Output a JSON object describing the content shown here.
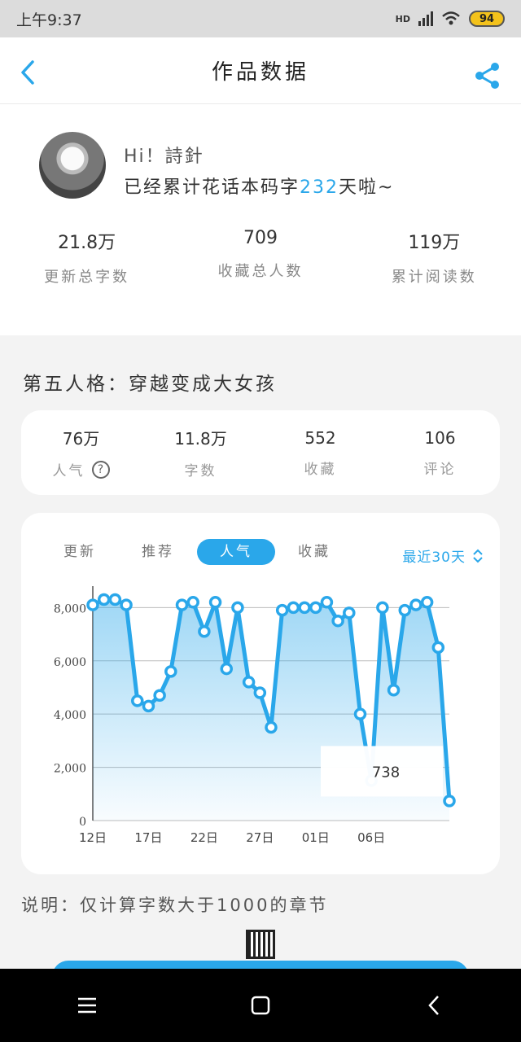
{
  "status": {
    "time": "上午9:37",
    "hd": "HD",
    "battery": "94"
  },
  "header": {
    "title": "作品数据"
  },
  "profile": {
    "greeting": "Hi！詩針",
    "words_prefix": "已经累计花话本码字",
    "days": "232",
    "words_suffix": "天啦~",
    "stats": [
      {
        "value": "21.8万",
        "label": "更新总字数"
      },
      {
        "value": "709",
        "label": "收藏总人数"
      },
      {
        "value": "119万",
        "label": "累计阅读数"
      }
    ]
  },
  "book": {
    "title": "第五人格：穿越变成大女孩",
    "stats": [
      {
        "value": "76万",
        "label": "人气"
      },
      {
        "value": "11.8万",
        "label": "字数"
      },
      {
        "value": "552",
        "label": "收藏"
      },
      {
        "value": "106",
        "label": "评论"
      }
    ]
  },
  "chart_tabs": [
    "更新",
    "推荐",
    "人气",
    "收藏"
  ],
  "active_tab": 2,
  "range_label": "最近30天",
  "tooltip_value": "738",
  "chart_data": {
    "type": "area",
    "x_tick_labels": [
      "12日",
      "17日",
      "22日",
      "27日",
      "01日",
      "06日"
    ],
    "x": [
      11,
      12,
      13,
      14,
      15,
      16,
      17,
      18,
      19,
      20,
      21,
      22,
      23,
      24,
      25,
      26,
      27,
      28,
      29,
      30,
      31,
      1,
      2,
      3,
      4,
      5,
      6,
      7,
      8,
      9,
      10,
      11
    ],
    "values": [
      8100,
      8300,
      8300,
      8100,
      4500,
      4300,
      4700,
      5600,
      8100,
      8200,
      7100,
      8200,
      5700,
      8000,
      5200,
      4800,
      3500,
      7900,
      8000,
      8000,
      8000,
      8200,
      7500,
      7800,
      4000,
      1500,
      8000,
      4900,
      7900,
      8100,
      8200,
      6500,
      738
    ],
    "ylim": [
      0,
      8500
    ],
    "y_ticks": [
      "0",
      "2,000",
      "4,000",
      "6,000",
      "8,000"
    ],
    "color": "#2aa7ea"
  },
  "footnote": "说明：仅计算字数大于1000的章节"
}
